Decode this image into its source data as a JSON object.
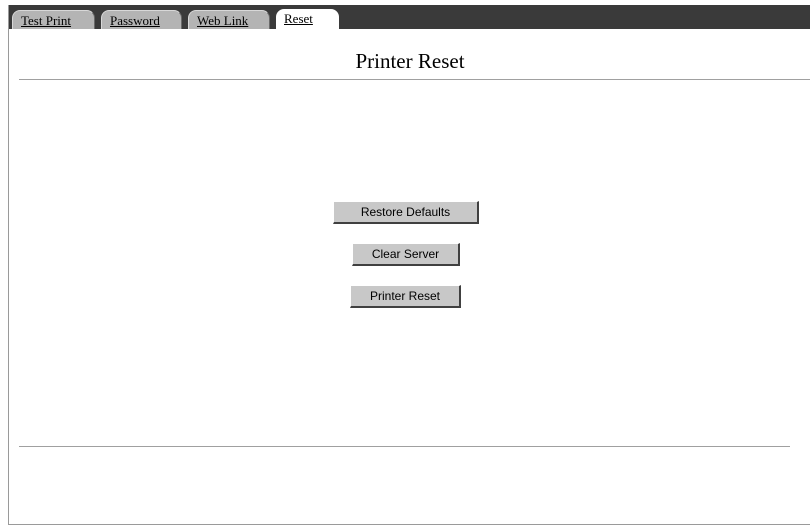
{
  "tabs": [
    {
      "label": "Test Print",
      "active": false
    },
    {
      "label": "Password",
      "active": false
    },
    {
      "label": "Web Link",
      "active": false
    },
    {
      "label": "Reset",
      "active": true
    }
  ],
  "page": {
    "title": "Printer Reset"
  },
  "actions": {
    "restore_defaults": "Restore Defaults",
    "clear_server": "Clear Server",
    "printer_reset": "Printer Reset"
  },
  "colors": {
    "tabbar_background": "#3a3a3a",
    "inactive_tab": "#b4b4b4",
    "active_tab": "#ffffff",
    "button_face": "#c8c8c8"
  }
}
